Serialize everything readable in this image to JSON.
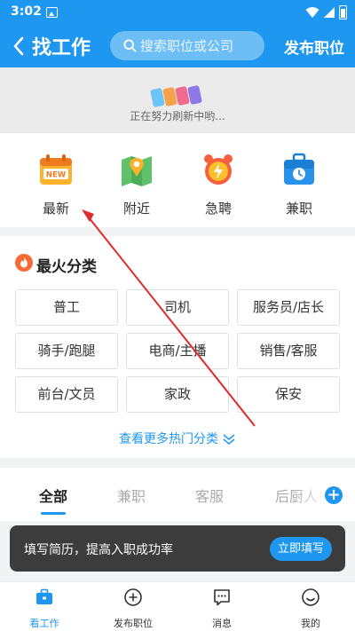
{
  "status_bar": {
    "time": "3:02"
  },
  "header": {
    "title": "找工作",
    "search_placeholder": "搜索职位或公司",
    "publish_label": "发布职位",
    "accent": "#1e97f0"
  },
  "refresh_banner": {
    "text": "正在努力刷新中哟..."
  },
  "quick_categories": [
    {
      "label": "最新",
      "icon": "new-calendar-icon"
    },
    {
      "label": "附近",
      "icon": "map-pin-icon"
    },
    {
      "label": "急聘",
      "icon": "alarm-clock-icon"
    },
    {
      "label": "兼职",
      "icon": "briefcase-clock-icon"
    }
  ],
  "hot": {
    "title": "最火分类",
    "chips": [
      "普工",
      "司机",
      "服务员/店长",
      "骑手/跑腿",
      "电商/主播",
      "销售/客服",
      "前台/文员",
      "家政",
      "保安"
    ],
    "more_label": "查看更多热门分类"
  },
  "tabs": [
    {
      "label": "全部",
      "active": true
    },
    {
      "label": "兼职",
      "active": false
    },
    {
      "label": "客服",
      "active": false
    },
    {
      "label": "后厨人",
      "active": false
    }
  ],
  "toast": {
    "message": "填写简历，提高入职成功率",
    "button": "立即填写"
  },
  "bottom_nav": [
    {
      "label": "看工作",
      "icon": "briefcase-icon",
      "active": true
    },
    {
      "label": "发布职位",
      "icon": "plus-circle-icon",
      "active": false
    },
    {
      "label": "消息",
      "icon": "message-icon",
      "active": false
    },
    {
      "label": "我的",
      "icon": "profile-smile-icon",
      "active": false
    }
  ]
}
